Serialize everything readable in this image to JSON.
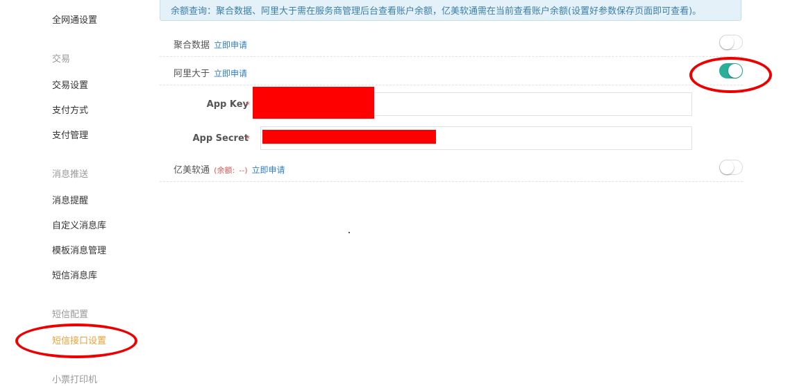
{
  "sidebar": {
    "items": [
      {
        "label": "全网通设置",
        "type": "item"
      },
      {
        "label": "交易",
        "type": "group"
      },
      {
        "label": "交易设置",
        "type": "item"
      },
      {
        "label": "支付方式",
        "type": "item"
      },
      {
        "label": "支付管理",
        "type": "item"
      },
      {
        "label": "消息推送",
        "type": "group"
      },
      {
        "label": "消息提醒",
        "type": "item"
      },
      {
        "label": "自定义消息库",
        "type": "item"
      },
      {
        "label": "模板消息管理",
        "type": "item"
      },
      {
        "label": "短信消息库",
        "type": "item"
      },
      {
        "label": "短信配置",
        "type": "group"
      },
      {
        "label": "短信接口设置",
        "type": "item",
        "active": true
      },
      {
        "label": "小票打印机",
        "type": "group"
      }
    ]
  },
  "notice": {
    "text": "余额查询：聚合数据、阿里大于需在服务商管理后台查看账户余额，亿美软通需在当前查看账户余额(设置好参数保存页面即可查看)。"
  },
  "providers": [
    {
      "name": "聚合数据",
      "apply_label": "立即申请",
      "enabled": false
    },
    {
      "name": "阿里大于",
      "apply_label": "立即申请",
      "enabled": true
    },
    {
      "name": "亿美软通",
      "balance_label": "(余额:",
      "balance_value": "--)",
      "apply_label": "立即申请",
      "enabled": false
    }
  ],
  "fields": {
    "app_key_label": "App Key",
    "app_secret_label": "App Secret",
    "required_mark": "*"
  },
  "colors": {
    "accent": "#2ab09a",
    "active_nav": "#e8a33a",
    "link": "#2e7ec4",
    "required": "#d9534f",
    "annotation": "#ee0000",
    "redaction": "#ff0000"
  }
}
